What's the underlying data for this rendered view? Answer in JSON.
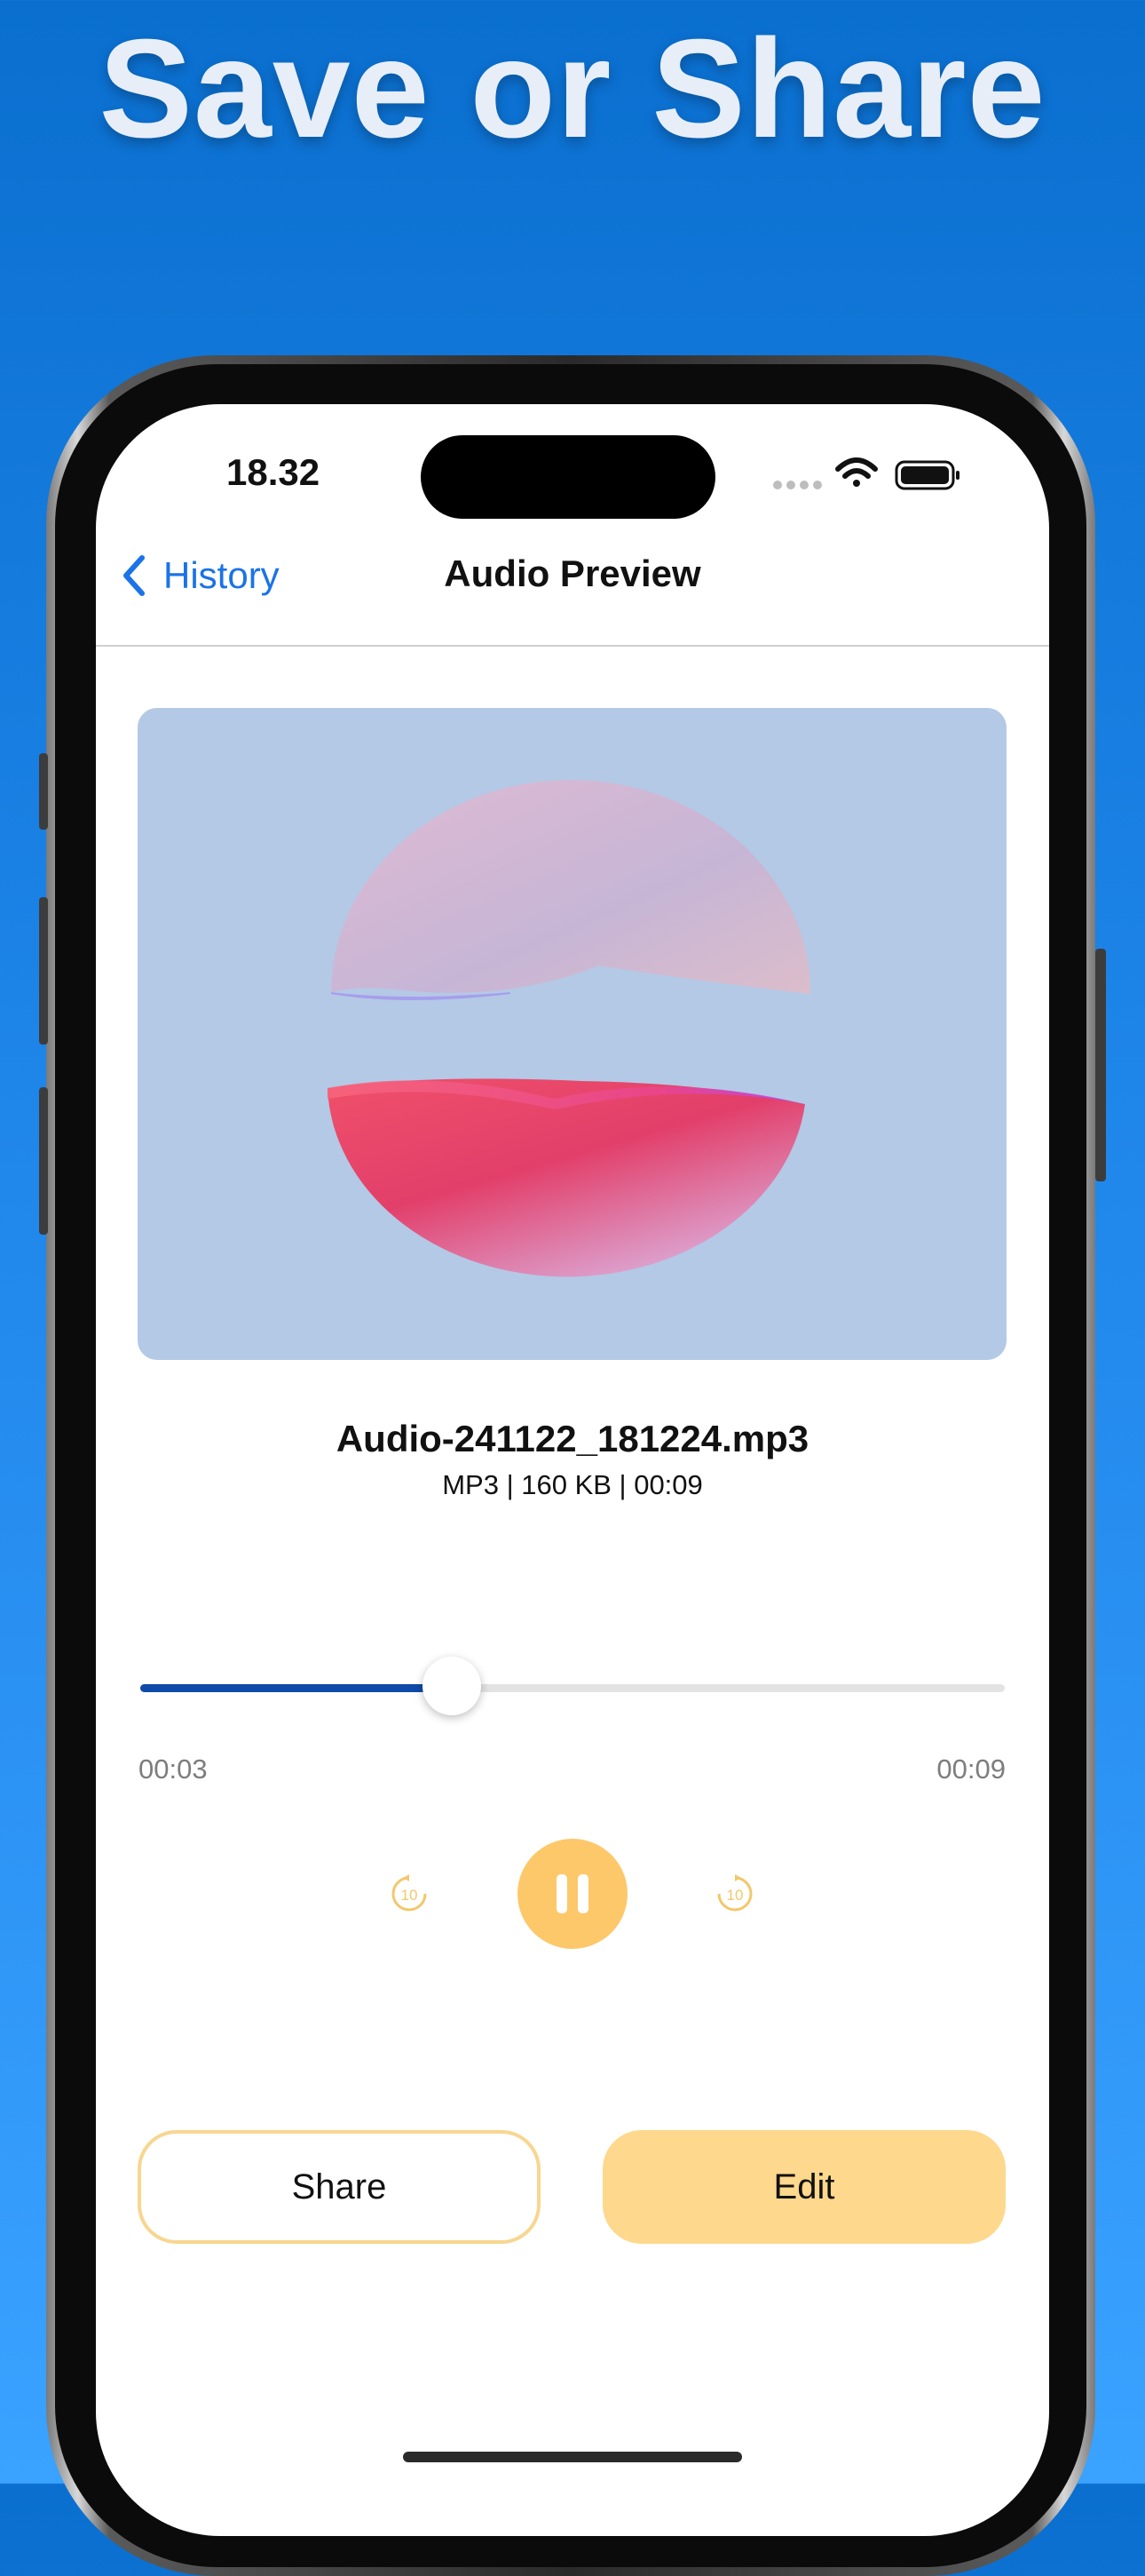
{
  "banner": {
    "headline": "Save or Share"
  },
  "status_bar": {
    "time": "18.32"
  },
  "nav": {
    "back_label": "History",
    "title": "Audio Preview"
  },
  "audio": {
    "file_name": "Audio-241122_181224.mp3",
    "meta": "MP3 | 160 KB | 00:09",
    "elapsed": "00:03",
    "duration": "00:09",
    "progress_fraction": 0.36,
    "skip_back_seconds": "10",
    "skip_forward_seconds": "10",
    "state": "playing"
  },
  "actions": {
    "share_label": "Share",
    "edit_label": "Edit"
  },
  "colors": {
    "accent_blue": "#1a73e8",
    "progress_fill": "#0f4aa8",
    "play_button": "#fdc86a",
    "edit_button": "#fed88c",
    "share_border": "#f8d690",
    "artwork_bg": "#b3c9e6"
  },
  "icons": {
    "back": "chevron-left-icon",
    "wifi": "wifi-icon",
    "battery": "battery-icon",
    "cellular": "cellular-dots-icon",
    "rewind": "rewind-10-icon",
    "forward": "forward-10-icon",
    "pause": "pause-icon"
  }
}
